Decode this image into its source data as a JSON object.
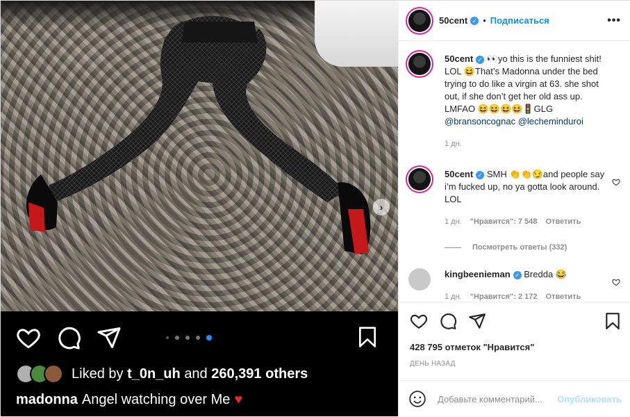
{
  "media": {
    "likes_prefix": "Liked by",
    "likes_user": "t_0n_uh",
    "likes_and": "and",
    "likes_others": "260,391 others",
    "caption_user": "madonna",
    "caption_text": "Angel watching over Me",
    "carousel": {
      "count": 5,
      "active_index": 4
    }
  },
  "header": {
    "username": "50cent",
    "follow_label": "Подписаться",
    "more_label": "•••"
  },
  "caption": {
    "username": "50cent",
    "text": "👀yo this is the funniest shit! LOL 😆That’s Madonna under the bed trying to do like a virgin at 63. she shot out, if she don’t get her old ass up. LMFAO 😆😆😆😆🚦GLG",
    "mentions": "@bransoncognac @lechemindurоi",
    "time": "1 дн."
  },
  "comments": [
    {
      "username": "50cent",
      "text": "SMH 👏👏😏and people say i’m fucked up, no ya gotta look around. LOL",
      "time": "1 дн.",
      "likes": "\"Нравится\": 7 548",
      "reply_label": "Ответить"
    },
    {
      "username": "kingbeenieman",
      "text": "Bredda 😂",
      "time": "1 дн.",
      "likes": "\"Нравится\": 2 172",
      "reply_label": "Ответить"
    }
  ],
  "view_replies": "Посмотреть ответы (332)",
  "actions": {
    "likes_count": "428 795 отметок \"Нравится\"",
    "day_ago": "ДЕНЬ НАЗАД",
    "comment_placeholder": "Добавьте комментарий...",
    "publish_label": "Опубликовать"
  },
  "colors": {
    "accent": "#0095f6",
    "verified": "#3897f0",
    "heart_red": "#e02b2b"
  }
}
